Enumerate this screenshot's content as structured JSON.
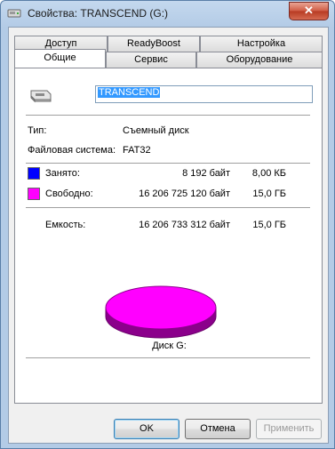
{
  "window": {
    "title": "Свойства: TRANSCEND (G:)",
    "close_glyph": "✕"
  },
  "tabs": {
    "row1": [
      "Доступ",
      "ReadyBoost",
      "Настройка"
    ],
    "row2": [
      "Общие",
      "Сервис",
      "Оборудование"
    ],
    "active": "Общие"
  },
  "general": {
    "drive_name": "TRANSCEND",
    "type_label": "Тип:",
    "type_value": "Съемный диск",
    "fs_label": "Файловая система:",
    "fs_value": "FAT32",
    "used_label": "Занято:",
    "used_bytes": "8 192 байт",
    "used_size": "8,00 КБ",
    "free_label": "Свободно:",
    "free_bytes": "16 206 725 120 байт",
    "free_size": "15,0 ГБ",
    "capacity_label": "Емкость:",
    "capacity_bytes": "16 206 733 312 байт",
    "capacity_size": "15,0 ГБ",
    "disk_label": "Диск G:",
    "used_color": "#0000ff",
    "free_color": "#ff00ff",
    "used_fraction": 5e-07
  },
  "buttons": {
    "ok": "OK",
    "cancel": "Отмена",
    "apply": "Применить"
  }
}
